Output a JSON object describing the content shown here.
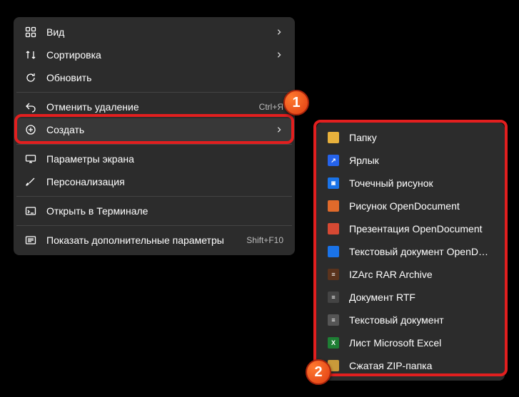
{
  "annotations": {
    "badge1": "1",
    "badge2": "2"
  },
  "main": {
    "items": [
      {
        "label": "Вид",
        "hint": "",
        "arrow": true
      },
      {
        "label": "Сортировка",
        "hint": "",
        "arrow": true
      },
      {
        "label": "Обновить",
        "hint": "",
        "arrow": false
      },
      {
        "sep": true
      },
      {
        "label": "Отменить удаление",
        "hint": "Ctrl+Я",
        "arrow": false
      },
      {
        "label": "Создать",
        "hint": "",
        "arrow": true,
        "hot": true
      },
      {
        "sep": true
      },
      {
        "label": "Параметры экрана",
        "hint": "",
        "arrow": false
      },
      {
        "label": "Персонализация",
        "hint": "",
        "arrow": false
      },
      {
        "sep": true
      },
      {
        "label": "Открыть в Терминале",
        "hint": "",
        "arrow": false
      },
      {
        "sep": true
      },
      {
        "label": "Показать дополнительные параметры",
        "hint": "Shift+F10",
        "arrow": false
      }
    ]
  },
  "sub": {
    "items": [
      {
        "label": "Папку"
      },
      {
        "label": "Ярлык"
      },
      {
        "label": "Точечный рисунок"
      },
      {
        "label": "Рисунок OpenDocument"
      },
      {
        "label": "Презентация OpenDocument"
      },
      {
        "label": "Текстовый документ OpenDocument"
      },
      {
        "label": "IZArc RAR Archive"
      },
      {
        "label": "Документ RTF"
      },
      {
        "label": "Текстовый документ"
      },
      {
        "label": "Лист Microsoft Excel"
      },
      {
        "label": "Сжатая ZIP-папка"
      }
    ]
  }
}
